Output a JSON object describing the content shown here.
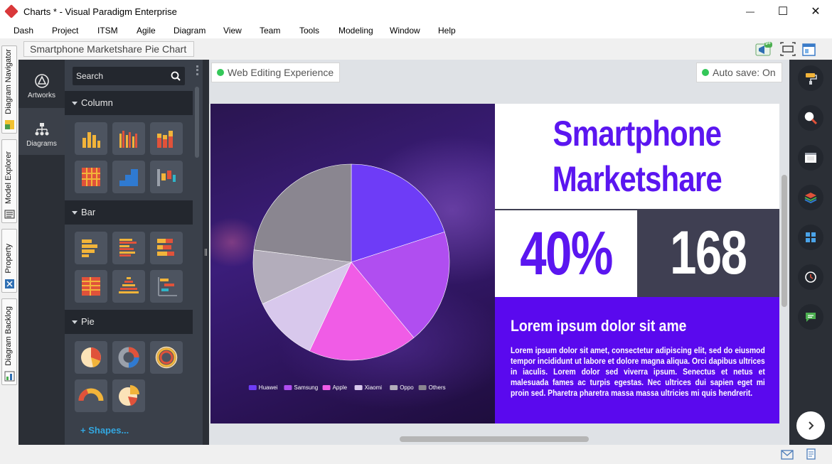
{
  "window": {
    "title": "Charts * - Visual Paradigm Enterprise",
    "minimize": "—",
    "maximize": "☐",
    "close": "✕"
  },
  "menu": [
    "Dash",
    "Project",
    "ITSM",
    "Agile",
    "Diagram",
    "View",
    "Team",
    "Tools",
    "Modeling",
    "Window",
    "Help"
  ],
  "breadcrumb": "Smartphone Marketshare Pie Chart",
  "notification_badge": "9+",
  "vtabs": [
    "Diagram Navigator",
    "Model Explorer",
    "Property",
    "Diagram Backlog"
  ],
  "left_column": {
    "artworks": "Artworks",
    "diagrams": "Diagrams"
  },
  "shapes_panel": {
    "search_placeholder": "Search",
    "sections": [
      "Column",
      "Bar",
      "Pie"
    ],
    "more_shapes": "+ Shapes..."
  },
  "canvas": {
    "web_editing": "Web Editing Experience",
    "autosave": "Auto save: On"
  },
  "slide": {
    "title_line1": "Smartphone",
    "title_line2": "Marketshare",
    "stat1": "40%",
    "stat2": "168",
    "text_heading": "Lorem ipsum dolor sit ame",
    "text_body": "Lorem ipsum dolor sit amet, consectetur adipiscing elit, sed do eiusmod tempor incididunt ut labore et dolore magna aliqua. Orci dapibus ultrices in iaculis. Lorem dolor sed viverra ipsum. Senectus et netus et malesuada fames ac turpis egestas. Nec ultrices dui sapien eget mi proin sed. Pharetra pharetra massa massa ultricies mi quis hendrerit.",
    "accent_color": "#5b16f0",
    "dark_color": "#3f3f52"
  },
  "chart_data": {
    "type": "pie",
    "categories": [
      "Huawei",
      "Samsung",
      "Apple",
      "Xiaomi",
      "Oppo",
      "Others"
    ],
    "values": [
      20,
      19,
      18,
      11,
      9,
      23
    ],
    "colors": [
      "#6e3cf7",
      "#b04ef0",
      "#f05ce6",
      "#d8c8ec",
      "#b3adbb",
      "#8a8690"
    ],
    "legend": "bottom"
  }
}
